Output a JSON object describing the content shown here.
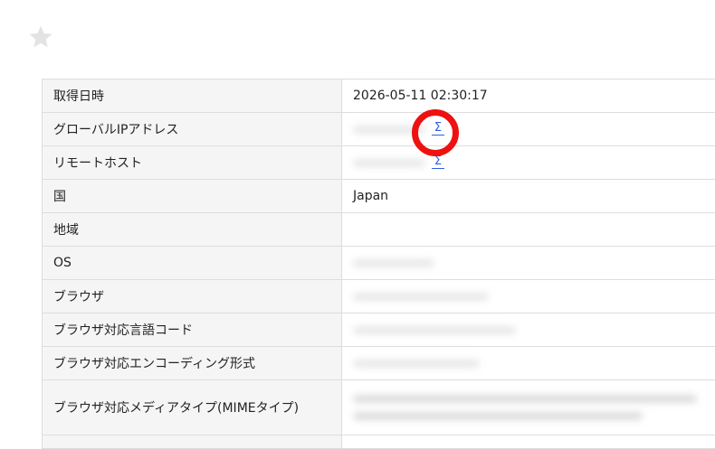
{
  "icons": {
    "star": "star-icon",
    "lookup": "sigma-lookup-icon"
  },
  "colors": {
    "annotation_ring": "#ee1111",
    "link_icon": "#2f5de0",
    "label_bg": "#f5f5f5",
    "border": "#dddddd"
  },
  "rows": [
    {
      "label": "取得日時",
      "value": "2026-05-11 02:30:17"
    },
    {
      "label": "グローバルIPアドレス",
      "value": ""
    },
    {
      "label": "リモートホスト",
      "value": ""
    },
    {
      "label": "国",
      "value": "Japan"
    },
    {
      "label": "地域",
      "value": ""
    },
    {
      "label": "OS",
      "value": ""
    },
    {
      "label": "ブラウザ",
      "value": ""
    },
    {
      "label": "ブラウザ対応言語コード",
      "value": ""
    },
    {
      "label": "ブラウザ対応エンコーディング形式",
      "value": ""
    },
    {
      "label": "ブラウザ対応メディアタイプ(MIMEタイプ)",
      "value": ""
    }
  ]
}
